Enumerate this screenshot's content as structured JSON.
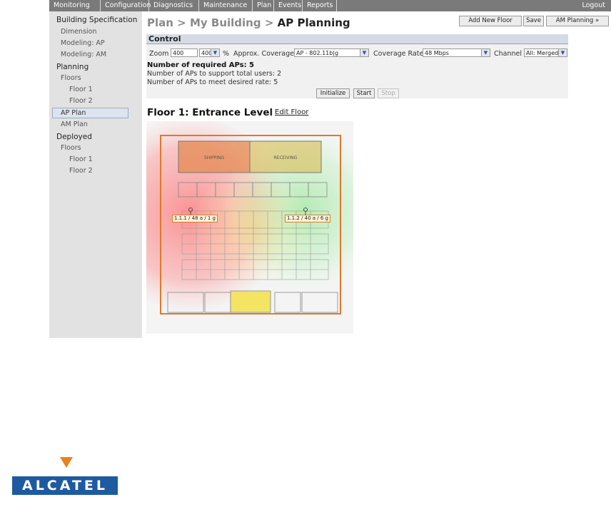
{
  "nav": {
    "tabs": [
      "Monitoring",
      "Configuration",
      "Diagnostics",
      "Maintenance",
      "Plan",
      "Events",
      "Reports"
    ],
    "logout": "Logout"
  },
  "sidebar": {
    "items": [
      {
        "label": "Building Specification",
        "kind": "head"
      },
      {
        "label": "Dimension",
        "kind": "sub"
      },
      {
        "label": "Modeling: AP",
        "kind": "sub"
      },
      {
        "label": "Modeling: AM",
        "kind": "sub"
      },
      {
        "label": "Planning",
        "kind": "head"
      },
      {
        "label": "Floors",
        "kind": "sub"
      },
      {
        "label": "Floor 1",
        "kind": "subsub"
      },
      {
        "label": "Floor 2",
        "kind": "subsub"
      },
      {
        "label": "AP Plan",
        "kind": "active"
      },
      {
        "label": "AM Plan",
        "kind": "sub"
      },
      {
        "label": "Deployed",
        "kind": "head"
      },
      {
        "label": "Floors",
        "kind": "sub"
      },
      {
        "label": "Floor 1",
        "kind": "subsub"
      },
      {
        "label": "Floor 2",
        "kind": "subsub"
      }
    ]
  },
  "breadcrumb": {
    "plan": "Plan",
    "building": "My Building",
    "current": "AP Planning",
    "sep": ">"
  },
  "toolbar": {
    "add_floor": "Add New Floor",
    "save": "Save",
    "am_planning": "AM Planning »"
  },
  "control": {
    "title": "Control",
    "zoom_label": "Zoom",
    "zoom_value": "400",
    "zoom_select": "400",
    "percent": "%",
    "coverage_label": "Approx. Coverage",
    "coverage_value": "AP - 802.11b|g",
    "rate_label": "Coverage Rate",
    "rate_value": "48 Mbps",
    "channel_label": "Channel",
    "channel_value": "All: Merged",
    "required": "Number of required APs: 5",
    "users": "Number of APs to support total users: 2",
    "rate_aps": "Number of APs to meet desired rate: 5",
    "btn_initialize": "Initialize",
    "btn_start": "Start",
    "btn_stop": "Stop"
  },
  "floor": {
    "title": "Floor 1: Entrance Level",
    "pipe": "|",
    "edit": "Edit Floor",
    "rooms": {
      "shipping": "SHIPPING",
      "receiving": "RECEIVING"
    },
    "ap1": "1.1.1 / 48 a / 1 g",
    "ap2": "1.1.2 / 40 a / 6 g"
  },
  "colors": {
    "nav": "#7a7a7a",
    "sidebar": "#e2e2e2",
    "control_header": "#d5dbe6",
    "logo_blue": "#1e5aa0",
    "logo_orange": "#e8821e"
  },
  "logo": {
    "text": "ALCATEL"
  }
}
